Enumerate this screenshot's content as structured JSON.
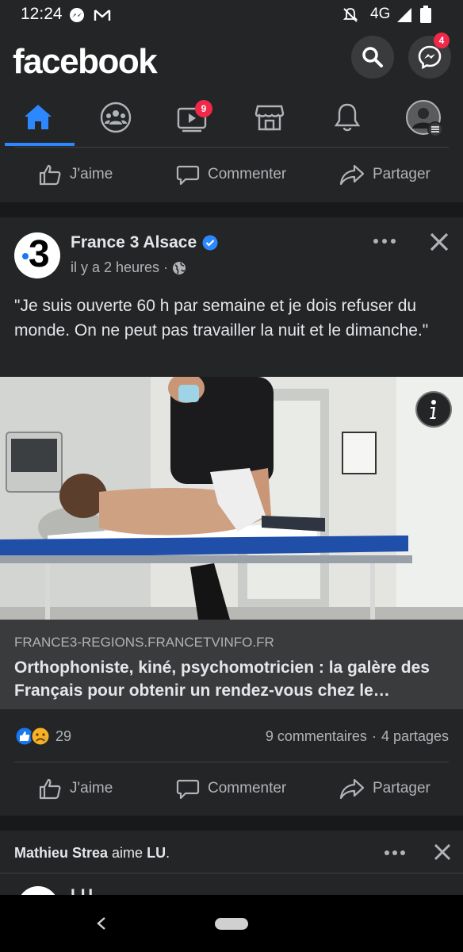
{
  "status_bar": {
    "time": "12:24",
    "network": "4G"
  },
  "header": {
    "logo": "facebook",
    "messenger_badge": "4"
  },
  "tabs": [
    {
      "name": "home",
      "icon": "home-icon",
      "badge": ""
    },
    {
      "name": "groups",
      "icon": "groups-icon",
      "badge": ""
    },
    {
      "name": "watch",
      "icon": "video-icon",
      "badge": "9"
    },
    {
      "name": "marketplace",
      "icon": "store-icon",
      "badge": ""
    },
    {
      "name": "notifications",
      "icon": "bell-icon",
      "badge": ""
    },
    {
      "name": "menu",
      "icon": "profile-menu-icon",
      "badge": ""
    }
  ],
  "actions": {
    "like": "J'aime",
    "comment": "Commenter",
    "share": "Partager"
  },
  "post": {
    "page_name": "France 3 Alsace",
    "time": "il y a 2 heures",
    "text": "\"Je suis ouverte 60 h par semaine et je dois refuser du monde. On ne peut pas travailler la nuit et le dimanche.\"",
    "link_domain": "FRANCE3-REGIONS.FRANCETVINFO.FR",
    "link_title": "Orthophoniste, kiné, psychomotricien : la galère des Français pour obtenir un rendez-vous chez le…",
    "reaction_count": "29",
    "comments": "9 commentaires",
    "shares": "4 partages"
  },
  "next_post": {
    "friend": "Mathieu Strea",
    "verb": "aime",
    "page": "LU",
    "page_name_partial": "LU"
  },
  "colors": {
    "accent": "#2d88ff",
    "background": "#18191a",
    "card": "#242526",
    "badge": "#f02849"
  }
}
